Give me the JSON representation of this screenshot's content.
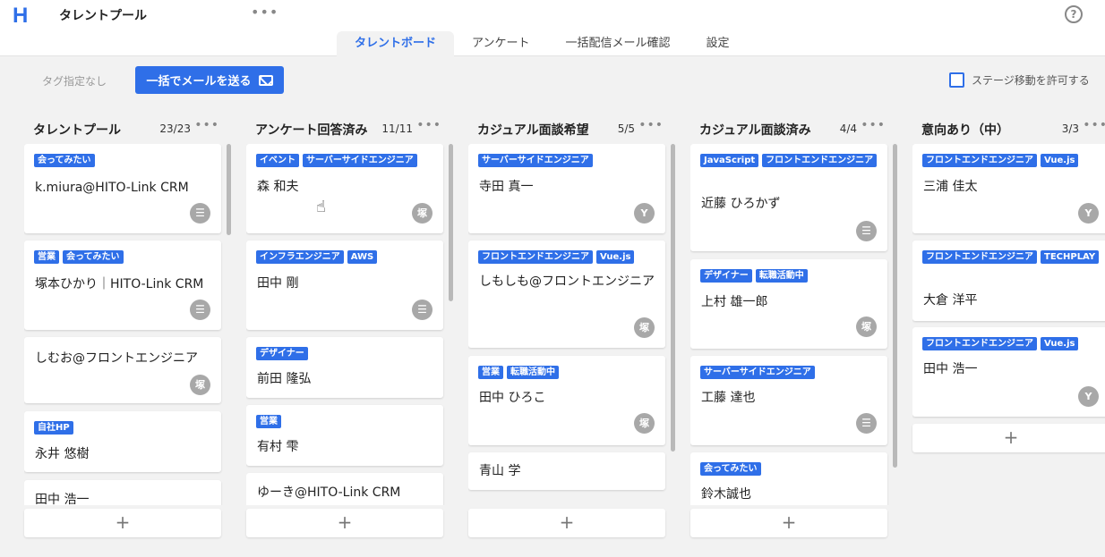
{
  "header": {
    "logo": "H",
    "title": "タレントプール",
    "more": "•••",
    "help": "?"
  },
  "tabs": [
    {
      "label": "タレントボード",
      "active": true
    },
    {
      "label": "アンケート"
    },
    {
      "label": "一括配信メール確認"
    },
    {
      "label": "設定"
    }
  ],
  "toolbar": {
    "tag_filter": "タグ指定なし",
    "send_mail": "一括でメールを送る",
    "stage_toggle": "ステージ移動を許可する"
  },
  "add_label": "+",
  "colors": {
    "accent": "#2f6fe8",
    "avatar": "#a8a8a8",
    "background": "#f2f2f2"
  },
  "columns": [
    {
      "title": "タレントプール",
      "count": "23/23",
      "cards": [
        {
          "tags": [
            "会ってみたい"
          ],
          "name": "k.miura@HITO-Link CRM",
          "avatar": "☰"
        },
        {
          "tags": [
            "営業",
            "会ってみたい"
          ],
          "name": "塚本ひかり｜HITO-Link CRM",
          "avatar": "☰"
        },
        {
          "tags": [],
          "name": "しむお@フロントエンジニア",
          "avatar": "塚"
        },
        {
          "tags": [
            "自社HP"
          ],
          "name": "永井 悠樹",
          "avatar": ""
        },
        {
          "tags": [],
          "name": "田中 浩一",
          "avatar": ""
        }
      ]
    },
    {
      "title": "アンケート回答済み",
      "count": "11/11",
      "cards": [
        {
          "tags": [
            "イベント",
            "サーバーサイドエンジニア"
          ],
          "name": "森 和夫",
          "avatar": "塚"
        },
        {
          "tags": [
            "インフラエンジニア",
            "AWS"
          ],
          "name": "田中 剛",
          "avatar": "☰"
        },
        {
          "tags": [
            "デザイナー"
          ],
          "name": "前田 隆弘",
          "avatar": ""
        },
        {
          "tags": [
            "営業"
          ],
          "name": "有村 雫",
          "avatar": ""
        },
        {
          "tags": [],
          "name": "ゆーき@HITO-Link CRM",
          "avatar": ""
        }
      ]
    },
    {
      "title": "カジュアル面談希望",
      "count": "5/5",
      "cards": [
        {
          "tags": [
            "サーバーサイドエンジニア"
          ],
          "name": "寺田 真一",
          "avatar": "Y"
        },
        {
          "tags": [
            "フロントエンドエンジニア",
            "Vue.js"
          ],
          "name": "しもしも@フロントエンジニア",
          "avatar": "塚"
        },
        {
          "tags": [
            "営業",
            "転職活動中"
          ],
          "name": "田中 ひろこ",
          "avatar": "塚"
        },
        {
          "tags": [],
          "name": "青山 学",
          "avatar": ""
        }
      ]
    },
    {
      "title": "カジュアル面談済み",
      "count": "4/4",
      "cards": [
        {
          "tags": [
            "JavaScript",
            "フロントエンドエンジニア"
          ],
          "name": "近藤 ひろかず",
          "avatar": "☰"
        },
        {
          "tags": [
            "デザイナー",
            "転職活動中"
          ],
          "name": "上村 雄一郎",
          "avatar": "塚"
        },
        {
          "tags": [
            "サーバーサイドエンジニア"
          ],
          "name": "工藤 達也",
          "avatar": "☰"
        },
        {
          "tags": [
            "会ってみたい"
          ],
          "name": "鈴木誠也",
          "avatar": ""
        }
      ]
    },
    {
      "title": "意向あり（中）",
      "count": "3/3",
      "cards": [
        {
          "tags": [
            "フロントエンドエンジニア",
            "Vue.js"
          ],
          "name": "三浦 佳太",
          "avatar": "Y"
        },
        {
          "tags": [
            "フロントエンドエンジニア",
            "TECHPLAY"
          ],
          "name": "大倉 洋平",
          "avatar": ""
        },
        {
          "tags": [
            "フロントエンドエンジニア",
            "Vue.js"
          ],
          "name": "田中 浩一",
          "avatar": "Y"
        }
      ]
    }
  ]
}
